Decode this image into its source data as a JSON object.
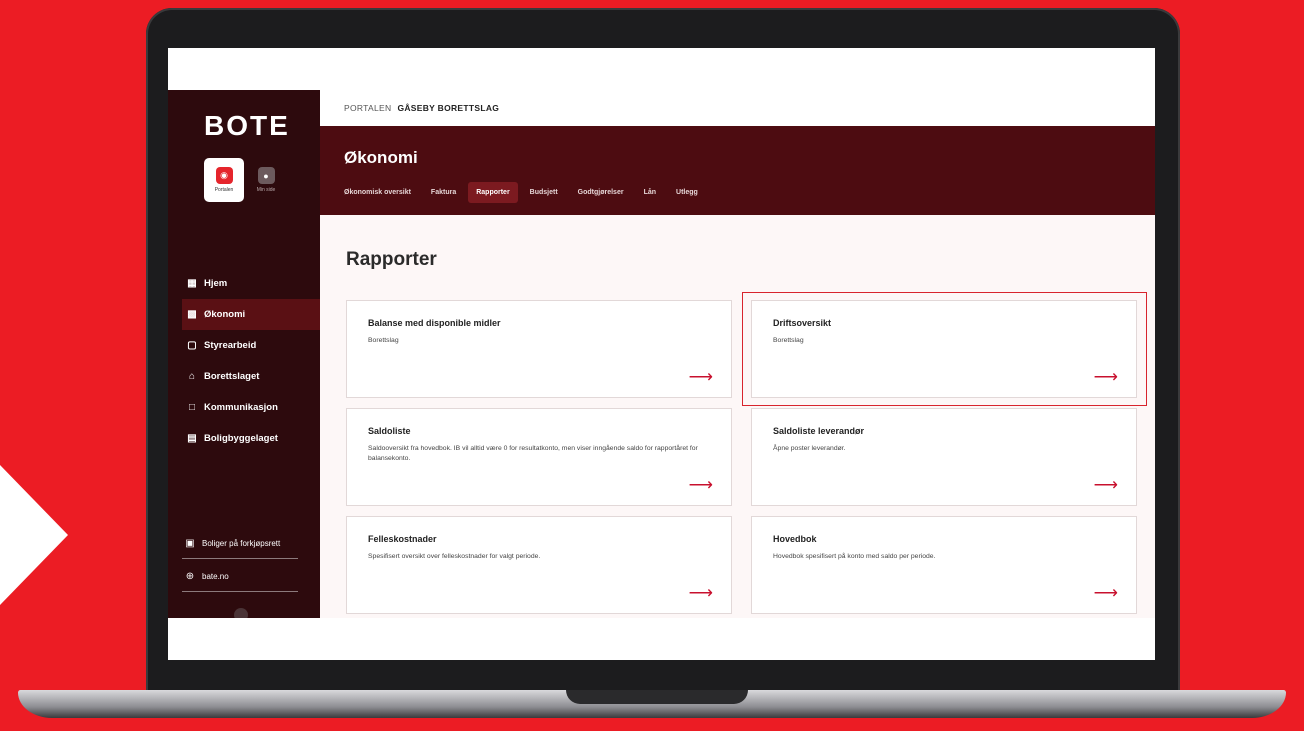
{
  "brand": {
    "logo": "BOTE"
  },
  "modes": [
    {
      "label": "Portalen",
      "icon": "portal-icon"
    },
    {
      "label": "Min side",
      "icon": "user-icon"
    }
  ],
  "sidebar": {
    "items": [
      {
        "label": "Hjem",
        "icon": "grid-icon"
      },
      {
        "label": "Økonomi",
        "icon": "chart-icon"
      },
      {
        "label": "Styrearbeid",
        "icon": "briefcase-icon"
      },
      {
        "label": "Borettslaget",
        "icon": "house-icon"
      },
      {
        "label": "Kommunikasjon",
        "icon": "chat-icon"
      },
      {
        "label": "Boligbyggelaget",
        "icon": "building-icon"
      }
    ],
    "bottom_links": [
      {
        "label": "Boliger på forkjøpsrett",
        "icon": "home-box-icon"
      },
      {
        "label": "bate.no",
        "icon": "globe-icon"
      }
    ]
  },
  "breadcrumb": {
    "root": "PORTALEN",
    "current": "GÅSEBY BORETTSLAG"
  },
  "header": {
    "title": "Økonomi",
    "tabs": [
      "Økonomisk oversikt",
      "Faktura",
      "Rapporter",
      "Budsjett",
      "Godtgjørelser",
      "Lån",
      "Utlegg"
    ],
    "active_tab": "Rapporter"
  },
  "main": {
    "title": "Rapporter",
    "cards": [
      {
        "title": "Balanse med disponible midler",
        "desc": "Borettslag"
      },
      {
        "title": "Driftsoversikt",
        "desc": "Borettslag"
      },
      {
        "title": "Saldoliste",
        "desc": "Saldooversikt fra hovedbok. IB vil alltid være 0 for resultatkonto, men viser inngående saldo for rapportåret for balansekonto."
      },
      {
        "title": "Saldoliste leverandør",
        "desc": "Åpne poster leverandør."
      },
      {
        "title": "Felleskostnader",
        "desc": "Spesifisert oversikt over felleskostnader for valgt periode."
      },
      {
        "title": "Hovedbok",
        "desc": "Hovedbok spesifisert på konto med saldo per periode."
      }
    ]
  },
  "colors": {
    "brand_red": "#ec1c24",
    "sidebar": "#2d0a0d",
    "header": "#4d0c11",
    "accent": "#c8102e"
  }
}
